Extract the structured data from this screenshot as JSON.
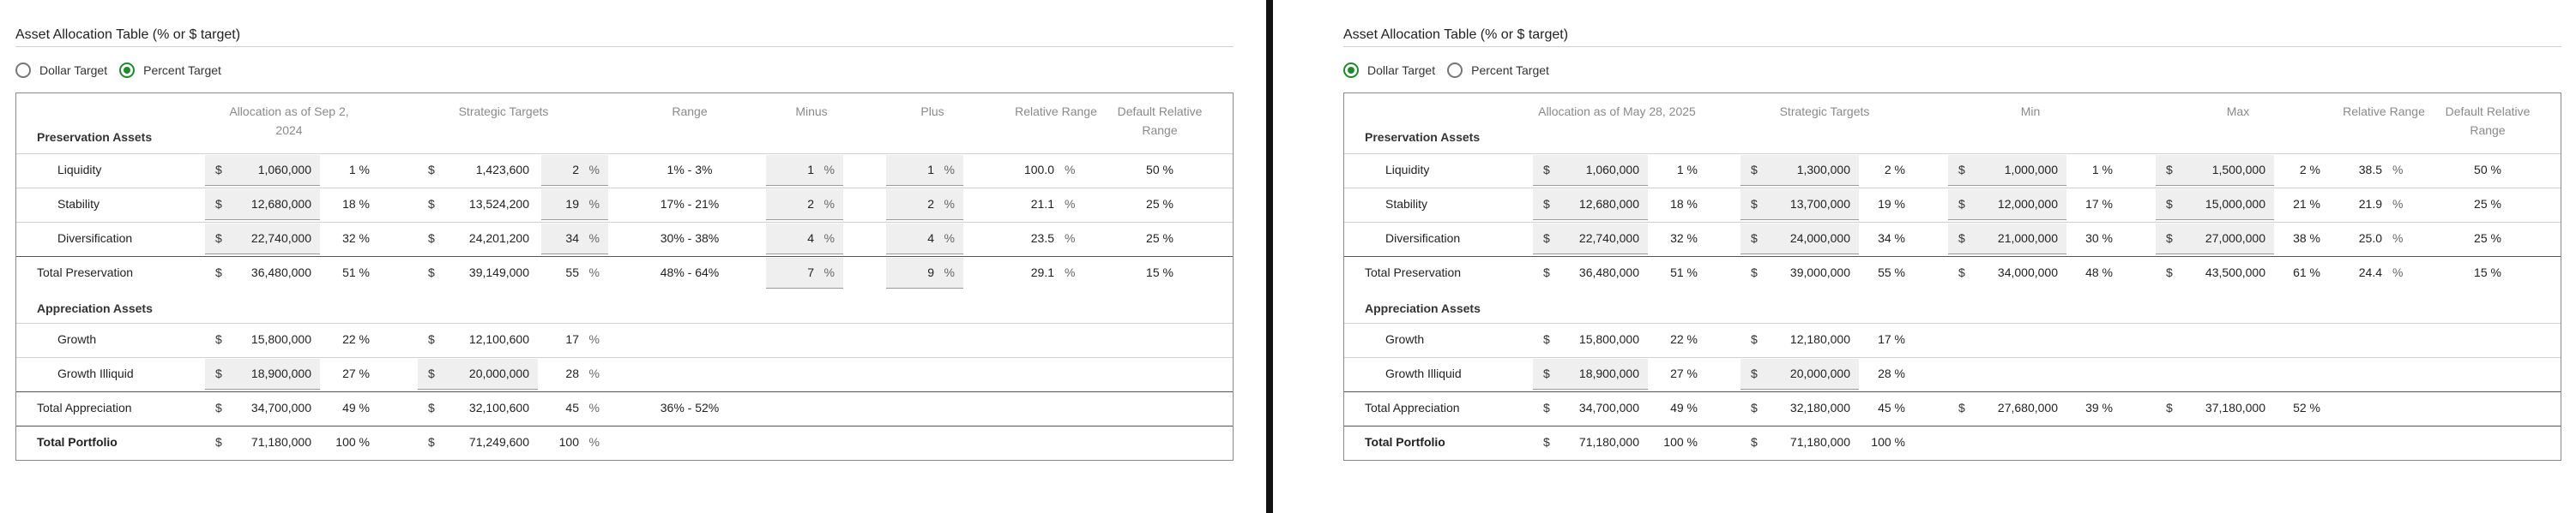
{
  "left": {
    "title": "Asset Allocation Table (% or $ target)",
    "radio_dollar": "Dollar Target",
    "radio_percent": "Percent Target",
    "selected": "percent",
    "headers": {
      "allocation": "Allocation as of Sep 2, 2024",
      "strategic": "Strategic Targets",
      "range": "Range",
      "minus": "Minus",
      "plus": "Plus",
      "relative_range": "Relative Range",
      "default_relative_range": "Default Relative Range"
    },
    "preservation_label": "Preservation Assets",
    "appreciation_label": "Appreciation Assets",
    "rows": {
      "liquidity": {
        "label": "Liquidity",
        "cur": "$",
        "alloc": "1,060,000",
        "alloc_pct": "1 %",
        "scur": "$",
        "target": "1,423,600",
        "target_pct": "2",
        "pct_sym": "%",
        "range": "1% - 3%",
        "minus": "1",
        "plus": "1",
        "rel": "100.0",
        "def": "50 %"
      },
      "stability": {
        "label": "Stability",
        "cur": "$",
        "alloc": "12,680,000",
        "alloc_pct": "18 %",
        "scur": "$",
        "target": "13,524,200",
        "target_pct": "19",
        "pct_sym": "%",
        "range": "17% - 21%",
        "minus": "2",
        "plus": "2",
        "rel": "21.1",
        "def": "25 %"
      },
      "diversification": {
        "label": "Diversification",
        "cur": "$",
        "alloc": "22,740,000",
        "alloc_pct": "32 %",
        "scur": "$",
        "target": "24,201,200",
        "target_pct": "34",
        "pct_sym": "%",
        "range": "30% - 38%",
        "minus": "4",
        "plus": "4",
        "rel": "23.5",
        "def": "25 %"
      },
      "total_preservation": {
        "label": "Total Preservation",
        "cur": "$",
        "alloc": "36,480,000",
        "alloc_pct": "51 %",
        "scur": "$",
        "target": "39,149,000",
        "target_pct": "55",
        "pct_sym": "%",
        "range": "48% - 64%",
        "minus": "7",
        "plus": "9",
        "rel": "29.1",
        "def": "15 %"
      },
      "growth": {
        "label": "Growth",
        "cur": "$",
        "alloc": "15,800,000",
        "alloc_pct": "22 %",
        "scur": "$",
        "target": "12,100,600",
        "target_pct": "17",
        "pct_sym": "%"
      },
      "growth_illiquid": {
        "label": "Growth Illiquid",
        "cur": "$",
        "alloc": "18,900,000",
        "alloc_pct": "27 %",
        "scur": "$",
        "target": "20,000,000",
        "target_pct": "28",
        "pct_sym": "%"
      },
      "total_appreciation": {
        "label": "Total Appreciation",
        "cur": "$",
        "alloc": "34,700,000",
        "alloc_pct": "49 %",
        "scur": "$",
        "target": "32,100,600",
        "target_pct": "45",
        "pct_sym": "%",
        "range": "36% - 52%"
      },
      "total_portfolio": {
        "label": "Total Portfolio",
        "cur": "$",
        "alloc": "71,180,000",
        "alloc_pct": "100 %",
        "scur": "$",
        "target": "71,249,600",
        "target_pct": "100",
        "pct_sym": "%"
      }
    },
    "pct_symbol": "%"
  },
  "right": {
    "title": "Asset Allocation Table (% or $ target)",
    "radio_dollar": "Dollar Target",
    "radio_percent": "Percent Target",
    "selected": "dollar",
    "headers": {
      "allocation": "Allocation as of May 28, 2025",
      "strategic": "Strategic Targets",
      "min": "Min",
      "max": "Max",
      "relative_range": "Relative Range",
      "default_relative_range": "Default Relative Range"
    },
    "preservation_label": "Preservation Assets",
    "appreciation_label": "Appreciation Assets",
    "rows": {
      "liquidity": {
        "label": "Liquidity",
        "cur": "$",
        "alloc": "1,060,000",
        "alloc_pct": "1 %",
        "target": "1,300,000",
        "target_pct": "2 %",
        "min": "1,000,000",
        "min_pct": "1 %",
        "max": "1,500,000",
        "max_pct": "2 %",
        "rel": "38.5",
        "def": "50 %"
      },
      "stability": {
        "label": "Stability",
        "cur": "$",
        "alloc": "12,680,000",
        "alloc_pct": "18 %",
        "target": "13,700,000",
        "target_pct": "19 %",
        "min": "12,000,000",
        "min_pct": "17 %",
        "max": "15,000,000",
        "max_pct": "21 %",
        "rel": "21.9",
        "def": "25 %"
      },
      "diversification": {
        "label": "Diversification",
        "cur": "$",
        "alloc": "22,740,000",
        "alloc_pct": "32 %",
        "target": "24,000,000",
        "target_pct": "34 %",
        "min": "21,000,000",
        "min_pct": "30 %",
        "max": "27,000,000",
        "max_pct": "38 %",
        "rel": "25.0",
        "def": "25 %"
      },
      "total_preservation": {
        "label": "Total Preservation",
        "cur": "$",
        "alloc": "36,480,000",
        "alloc_pct": "51 %",
        "target": "39,000,000",
        "target_pct": "55 %",
        "min": "34,000,000",
        "min_pct": "48 %",
        "max": "43,500,000",
        "max_pct": "61 %",
        "rel": "24.4",
        "def": "15 %"
      },
      "growth": {
        "label": "Growth",
        "cur": "$",
        "alloc": "15,800,000",
        "alloc_pct": "22 %",
        "target": "12,180,000",
        "target_pct": "17 %"
      },
      "growth_illiquid": {
        "label": "Growth Illiquid",
        "cur": "$",
        "alloc": "18,900,000",
        "alloc_pct": "27 %",
        "target": "20,000,000",
        "target_pct": "28 %"
      },
      "total_appreciation": {
        "label": "Total Appreciation",
        "cur": "$",
        "alloc": "34,700,000",
        "alloc_pct": "49 %",
        "target": "32,180,000",
        "target_pct": "45 %",
        "min": "27,680,000",
        "min_pct": "39 %",
        "max": "37,180,000",
        "max_pct": "52 %"
      },
      "total_portfolio": {
        "label": "Total Portfolio",
        "cur": "$",
        "alloc": "71,180,000",
        "alloc_pct": "100 %",
        "target": "71,180,000",
        "target_pct": "100 %"
      }
    },
    "pct_symbol": "%"
  }
}
